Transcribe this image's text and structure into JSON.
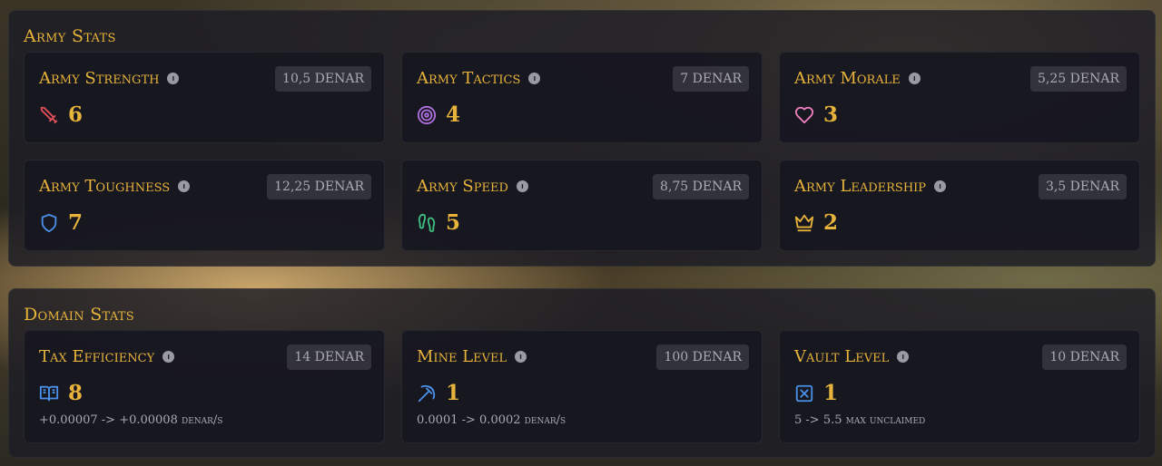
{
  "army": {
    "title": "Army Stats",
    "stats": [
      {
        "name": "Army Strength",
        "price": "10,5 DENAR",
        "value": "6",
        "icon": "sword-icon",
        "color": "#e0505a"
      },
      {
        "name": "Army Tactics",
        "price": "7 DENAR",
        "value": "4",
        "icon": "target-icon",
        "color": "#b070e0"
      },
      {
        "name": "Army Morale",
        "price": "5,25 DENAR",
        "value": "3",
        "icon": "heart-icon",
        "color": "#f080c0"
      },
      {
        "name": "Army Toughness",
        "price": "12,25 DENAR",
        "value": "7",
        "icon": "shield-icon",
        "color": "#4a90e8"
      },
      {
        "name": "Army Speed",
        "price": "8,75 DENAR",
        "value": "5",
        "icon": "footprints-icon",
        "color": "#40c080"
      },
      {
        "name": "Army Leadership",
        "price": "3,5 DENAR",
        "value": "2",
        "icon": "crown-icon",
        "color": "#e7b33a"
      }
    ]
  },
  "domain": {
    "title": "Domain Stats",
    "stats": [
      {
        "name": "Tax Efficiency",
        "price": "14 DENAR",
        "value": "8",
        "sub": "+0.00007 -> +0.00008 denar/s",
        "icon": "book-icon",
        "color": "#4a90e8"
      },
      {
        "name": "Mine Level",
        "price": "100 DENAR",
        "value": "1",
        "sub": "0.0001 -> 0.0002 denar/s",
        "icon": "pickaxe-icon",
        "color": "#4a90e8"
      },
      {
        "name": "Vault Level",
        "price": "10 DENAR",
        "value": "1",
        "sub": "5 -> 5.5 max unclaimed",
        "icon": "vault-icon",
        "color": "#4a90e8"
      }
    ]
  }
}
